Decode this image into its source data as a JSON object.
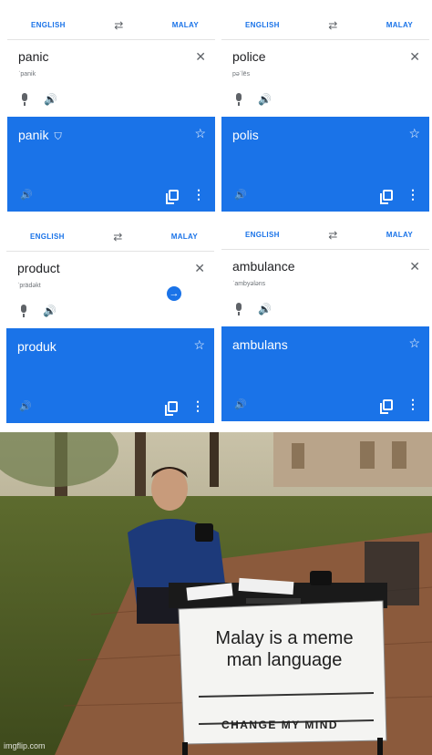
{
  "panels": [
    {
      "source_lang": "ENGLISH",
      "target_lang": "MALAY",
      "input": "panic",
      "phonetic": "ˈpanik",
      "translation": "panik",
      "verified": true,
      "go_button": false
    },
    {
      "source_lang": "ENGLISH",
      "target_lang": "MALAY",
      "input": "police",
      "phonetic": "pəˈlēs",
      "translation": "polis",
      "verified": false,
      "go_button": false
    },
    {
      "source_lang": "ENGLISH",
      "target_lang": "MALAY",
      "input": "product",
      "phonetic": "ˈprädəkt",
      "translation": "produk",
      "verified": false,
      "go_button": true
    },
    {
      "source_lang": "ENGLISH",
      "target_lang": "MALAY",
      "input": "ambulance",
      "phonetic": "ˈambyələns",
      "translation": "ambulans",
      "verified": false,
      "go_button": false
    }
  ],
  "meme": {
    "sign_text": "Malay is a meme man language",
    "sign_banner": "CHANGE MY MIND",
    "watermark": "imgflip.com"
  },
  "colors": {
    "accent": "#1a73e8",
    "result_bg": "#1a73e8"
  }
}
